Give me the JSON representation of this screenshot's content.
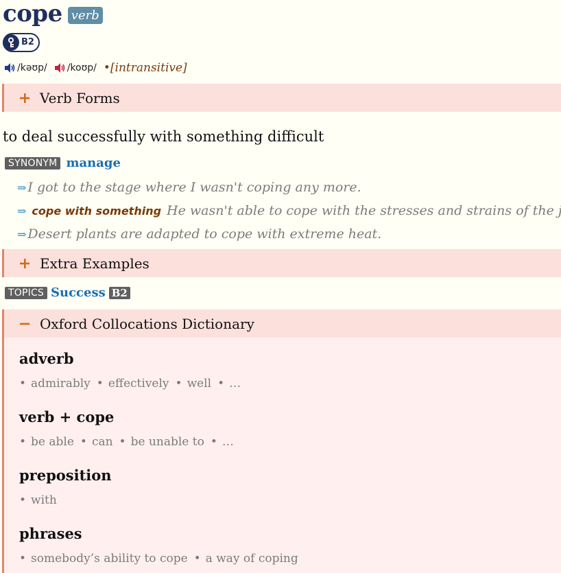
{
  "entry": {
    "headword": "cope",
    "pos": "verb",
    "cefr_level": "B2",
    "pron_br": "/kəʊp/",
    "pron_us": "/koʊp/",
    "grammar": "[intransitive]",
    "grammar_bullet": "•"
  },
  "sections": {
    "verb_forms": "Verb Forms",
    "extra_examples": "Extra Examples",
    "collocations": "Oxford Collocations Dictionary"
  },
  "sense": {
    "definition": "to deal successfully with something difficult",
    "synonym_label": "SYNONYM",
    "synonym": "manage",
    "examples": [
      {
        "cf": "",
        "text": "I got to the stage where I wasn't coping any more."
      },
      {
        "cf": "cope with something",
        "text": "He wasn't able to cope with the stresses and strains of the job."
      },
      {
        "cf": "",
        "text": "Desert plants are adapted to cope with extreme heat."
      }
    ]
  },
  "topics": {
    "label": "TOPICS",
    "topic": "Success",
    "level": "B2"
  },
  "collocations": [
    {
      "heading": "adverb",
      "items": [
        "admirably",
        "effectively",
        "well",
        "…"
      ]
    },
    {
      "heading": "verb + cope",
      "items": [
        "be able",
        "can",
        "be unable to",
        "…"
      ]
    },
    {
      "heading": "preposition",
      "items": [
        "with"
      ]
    },
    {
      "heading": "phrases",
      "items": [
        "somebody’s ability to cope",
        "a way of coping"
      ]
    }
  ],
  "colors": {
    "headword": "#1f2f5c",
    "link": "#1a6db3",
    "section_bg": "#fbe0dc",
    "section_accent": "#e2846b",
    "toggle": "#d26a1e",
    "br_speaker": "#1f3a8a",
    "us_speaker": "#c0244a"
  },
  "icons": {
    "br_audio": "speaker-blue-icon",
    "us_audio": "speaker-red-icon",
    "cefr": "oxford-key-icon",
    "expand": "plus-icon",
    "collapse": "minus-icon",
    "example_marker": "double-arrow-icon"
  }
}
